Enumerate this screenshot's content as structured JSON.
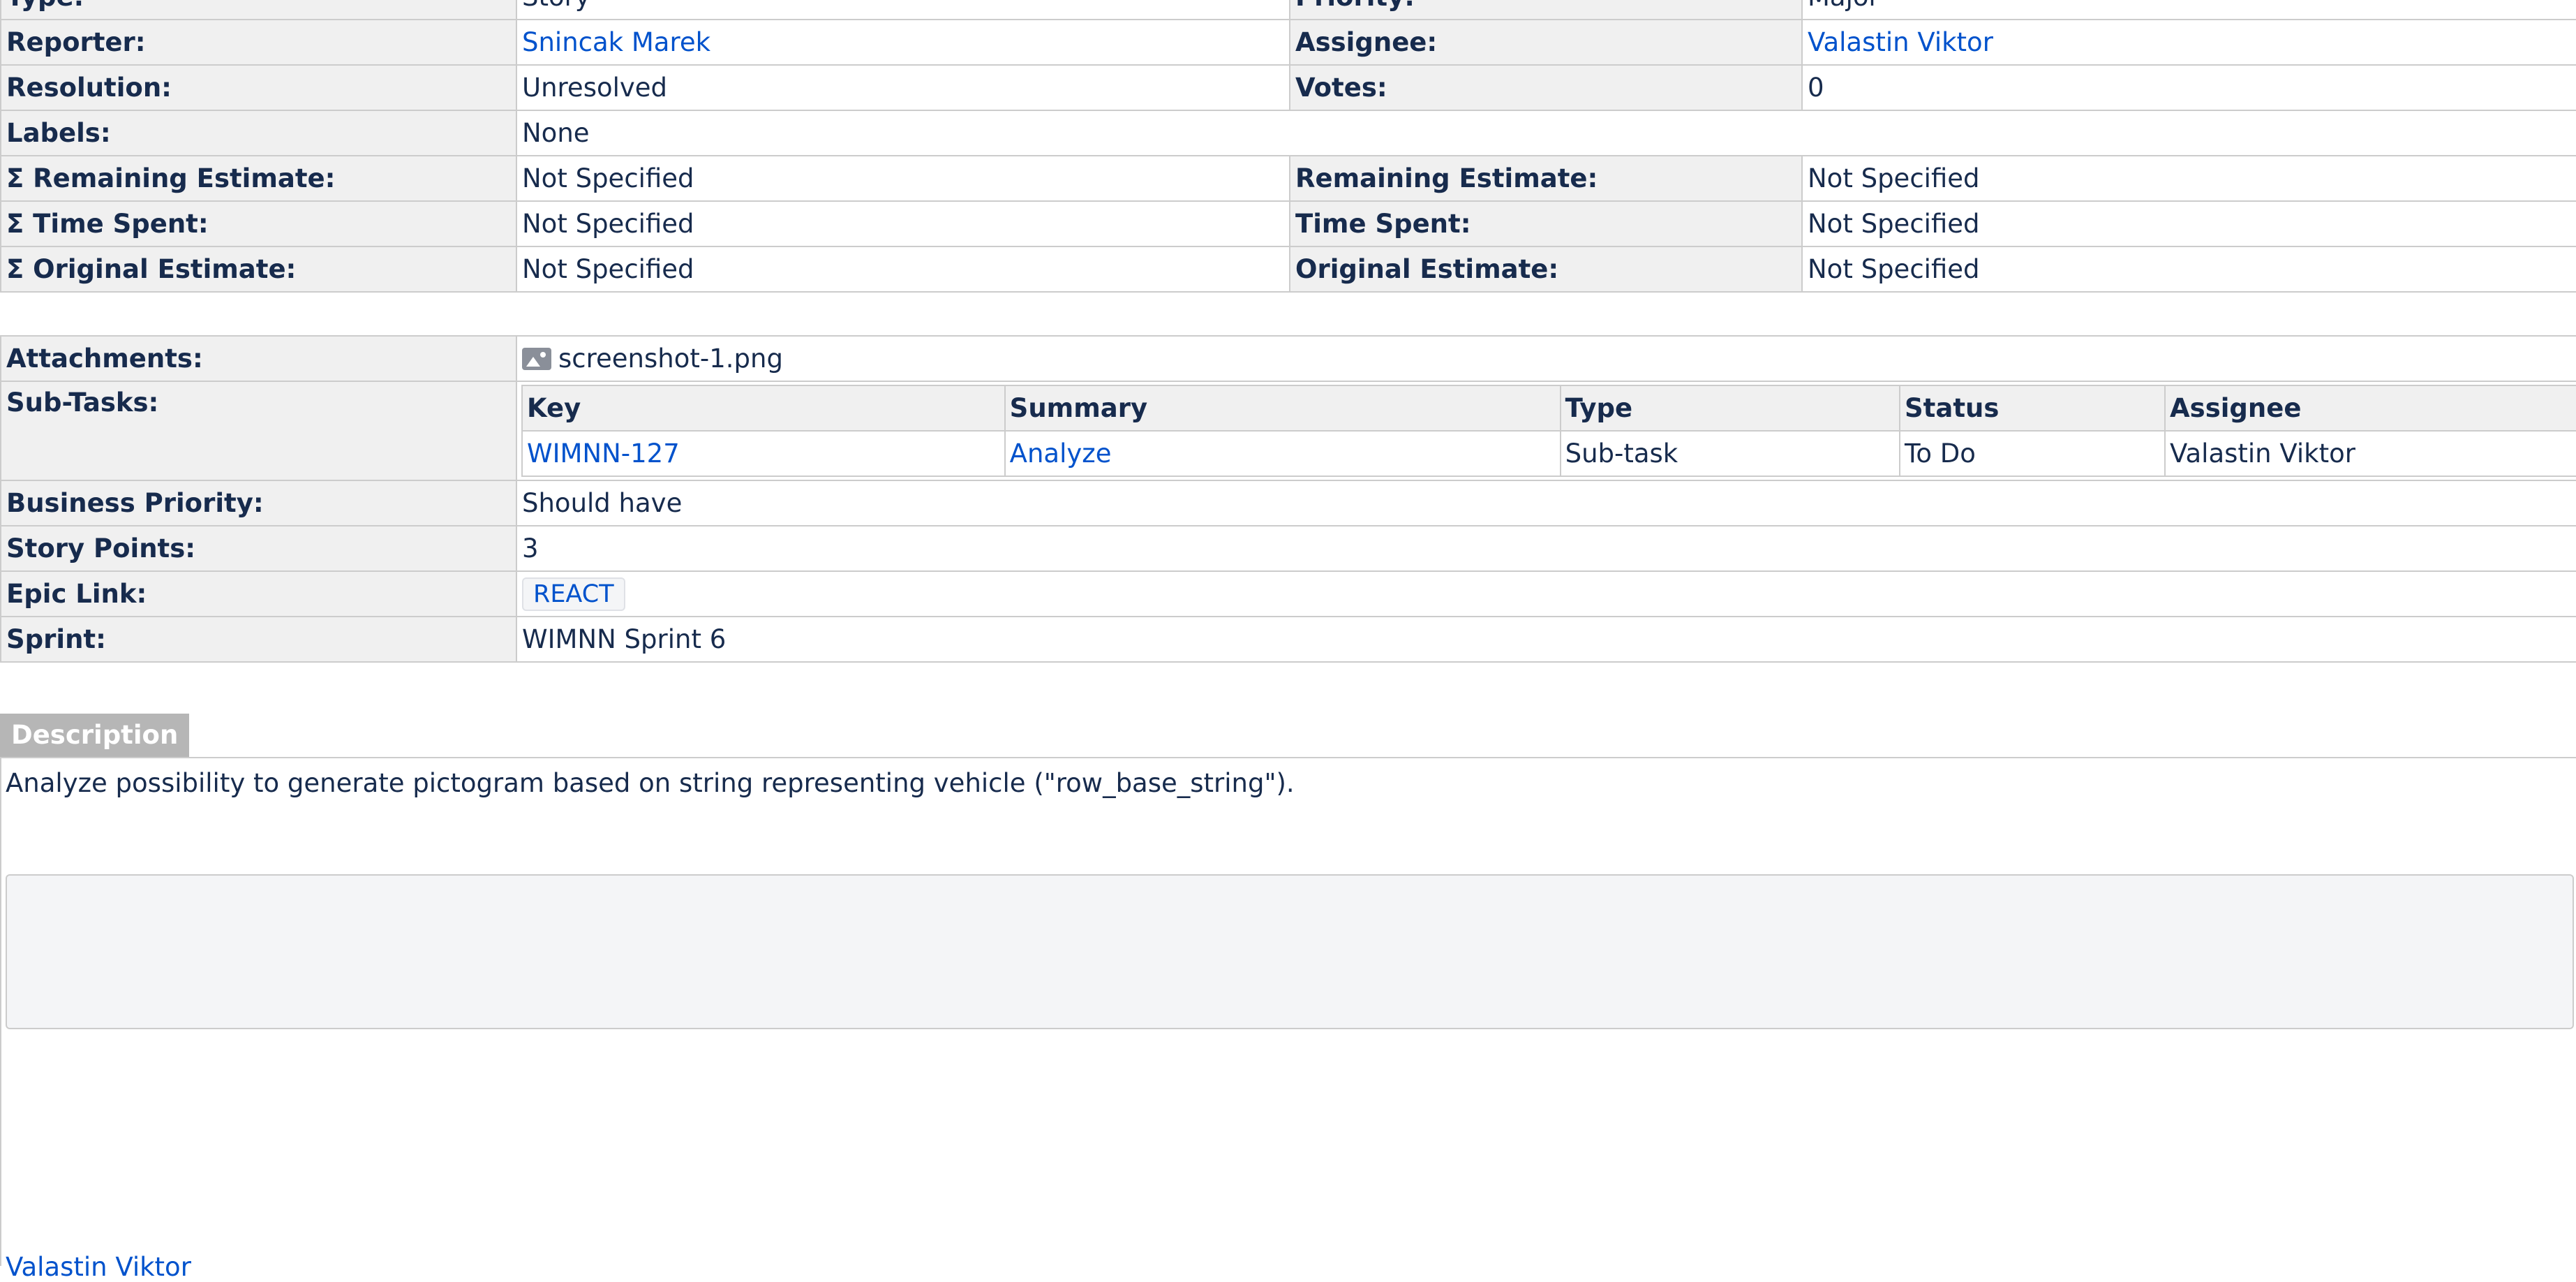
{
  "top_fields": [
    {
      "l1": "Type:",
      "v1": "Story",
      "l2": "Priority:",
      "v2": "Major"
    },
    {
      "l1": "Reporter:",
      "v1": "Snincak Marek",
      "l2": "Assignee:",
      "v2": "Valastin Viktor"
    },
    {
      "l1": "Resolution:",
      "v1": "Unresolved",
      "l2": "Votes:",
      "v2": "0"
    },
    {
      "l1": "Labels:",
      "v1": "None"
    },
    {
      "l1": "Σ Remaining Estimate:",
      "v1": "Not Specified",
      "l2": "Remaining Estimate:",
      "v2": "Not Specified"
    },
    {
      "l1": "Σ Time Spent:",
      "v1": "Not Specified",
      "l2": "Time Spent:",
      "v2": "Not Specified"
    },
    {
      "l1": "Σ Original Estimate:",
      "v1": "Not Specified",
      "l2": "Original Estimate:",
      "v2": "Not Specified"
    }
  ],
  "attachments": {
    "label": "Attachments:",
    "file": "screenshot-1.png",
    "icon": "image-file-icon"
  },
  "subtasks": {
    "label": "Sub-Tasks:",
    "headers": [
      "Key",
      "Summary",
      "Type",
      "Status",
      "Assignee"
    ],
    "rows": [
      [
        "WIMNN-127",
        "Analyze",
        "Sub-task",
        "To Do",
        "Valastin Viktor"
      ]
    ]
  },
  "details": [
    {
      "label": "Business Priority:",
      "value": "Should have"
    },
    {
      "label": "Story Points:",
      "value": "3"
    },
    {
      "label": "Epic Link:",
      "value": "REACT"
    },
    {
      "label": "Sprint:",
      "value": "WIMNN Sprint 6"
    }
  ],
  "description": {
    "tab": "Description",
    "text": "Analyze possibility to generate pictogram based on string representing vehicle (\"row_base_string\")."
  },
  "bottom_link": "Valastin Viktor"
}
